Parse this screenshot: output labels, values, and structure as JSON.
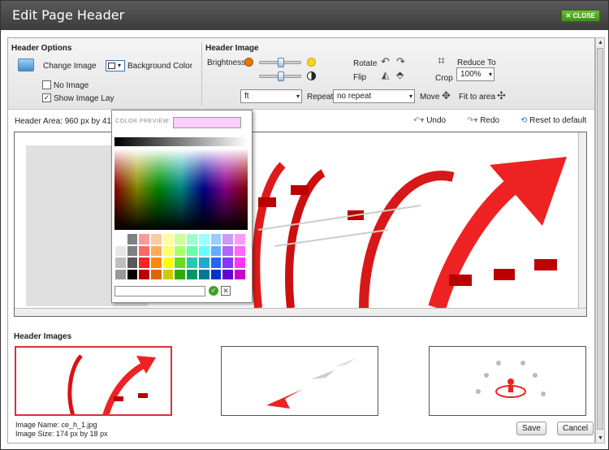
{
  "dialog": {
    "title": "Edit Page Header",
    "close_label": "CLOSE"
  },
  "header_options": {
    "section_title": "Header Options",
    "change_image_label": "Change Image",
    "background_color_label": "Background Color",
    "no_image_label": "No Image",
    "no_image_checked": false,
    "show_image_layer_label": "Show Image Lay",
    "show_image_layer_checked": true
  },
  "header_image": {
    "section_title": "Header Image",
    "brightness_label": "Brightness",
    "rotate_label": "Rotate",
    "flip_label": "Flip",
    "crop_label": "Crop",
    "reduce_to_label": "Reduce To",
    "reduce_to_value": "100%",
    "position_value": "ft",
    "repeat_label": "Repeat",
    "repeat_value": "no repeat",
    "move_label": "Move",
    "fit_to_area_label": "Fit to area"
  },
  "area": {
    "label": "Header Area: 960 px by 411 p"
  },
  "history": {
    "undo_label": "Undo",
    "redo_label": "Redo",
    "reset_label": "Reset to default"
  },
  "color_picker": {
    "preview_label": "COLOR PREVIEW:",
    "preview_color": "#ffccff",
    "hex_value": "",
    "swatches": [
      "#ffffff",
      "#808080",
      "#ff9999",
      "#ffcc99",
      "#ffff99",
      "#ccff99",
      "#99ffcc",
      "#99ffff",
      "#99ccff",
      "#cc99ff",
      "#ff99ff",
      "#e6e6e6",
      "#808080",
      "#ff6666",
      "#ffaa55",
      "#ffff66",
      "#aaff66",
      "#66ffaa",
      "#66ffff",
      "#66aaff",
      "#aa66ff",
      "#ff66ff",
      "#bfbfbf",
      "#595959",
      "#ff2222",
      "#ff8800",
      "#ffff00",
      "#66dd22",
      "#22ccaa",
      "#22aacc",
      "#2266ff",
      "#8833ff",
      "#ff33ff",
      "#999999",
      "#000000",
      "#bb0000",
      "#dd6600",
      "#cccc00",
      "#33aa00",
      "#009966",
      "#007799",
      "#0033cc",
      "#6600cc",
      "#cc00cc"
    ]
  },
  "header_images": {
    "section_title": "Header Images",
    "image_name": "Image Name: ce_h_1.jpg",
    "image_size": "Image Size: 174 px by 18 px"
  },
  "actions": {
    "save_label": "Save",
    "cancel_label": "Cancel"
  },
  "colors": {
    "accent_red": "#d63333",
    "green_close": "#4fa82a"
  }
}
